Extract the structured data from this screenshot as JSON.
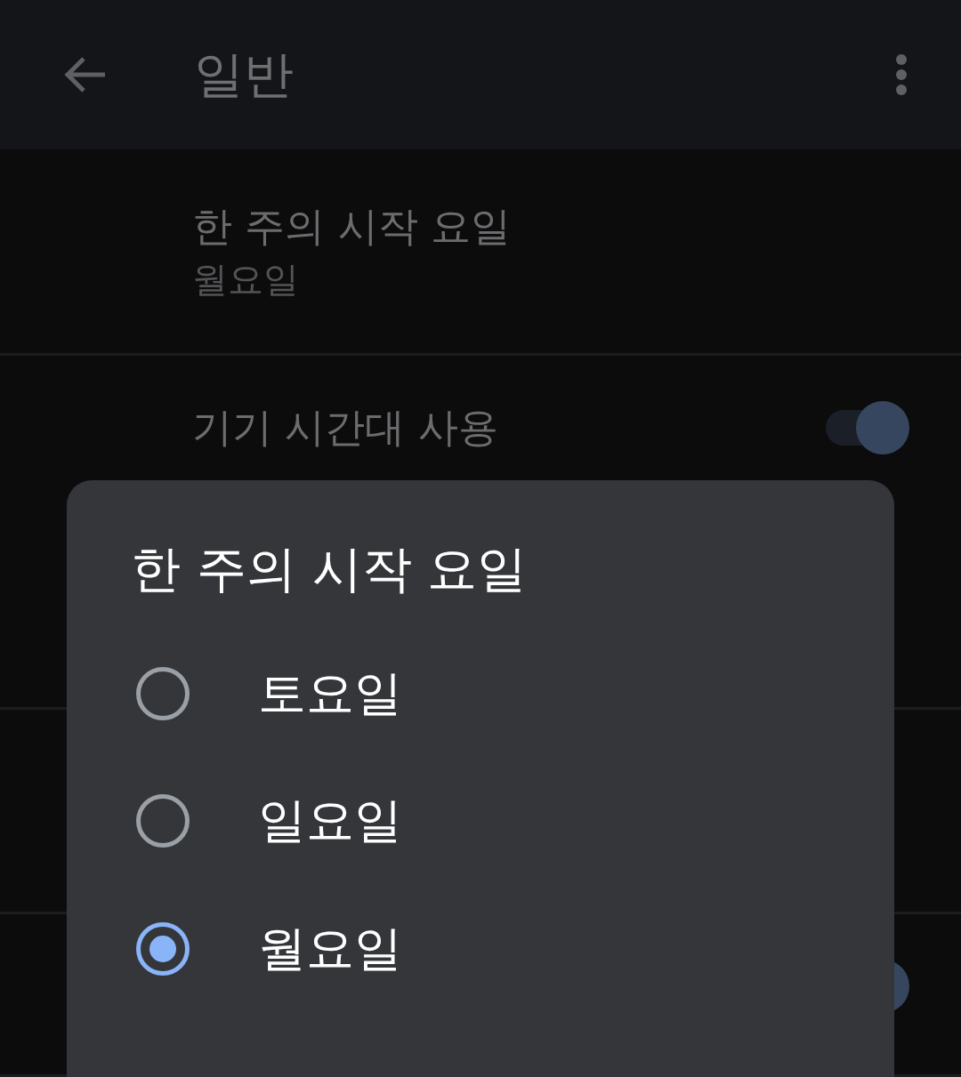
{
  "app_bar": {
    "title": "일반"
  },
  "settings": [
    {
      "kind": "value",
      "title": "한 주의 시작 요일",
      "value": "월요일"
    },
    {
      "kind": "toggle",
      "title": "기기 시간대 사용",
      "on": true
    },
    {
      "kind": "toggle",
      "on": true
    }
  ],
  "dialog": {
    "title": "한 주의 시작 요일",
    "options": [
      {
        "label": "토요일",
        "selected": false
      },
      {
        "label": "일요일",
        "selected": false
      },
      {
        "label": "월요일",
        "selected": true
      }
    ]
  }
}
